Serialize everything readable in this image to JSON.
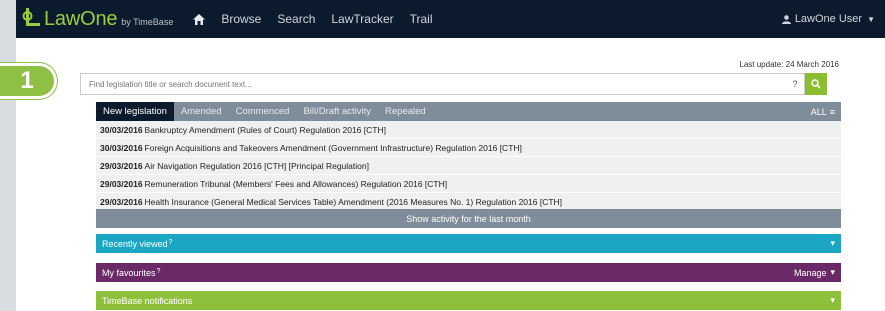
{
  "brand": {
    "name": "LawOne",
    "sub": "by TimeBase"
  },
  "nav": [
    "Browse",
    "Search",
    "LawTracker",
    "Trail"
  ],
  "user": {
    "name": "LawOne User"
  },
  "last_update": "Last update: 24 March 2016",
  "search": {
    "placeholder": "Find legislation title or search document text...",
    "help": "?"
  },
  "badge": "1",
  "tabs": [
    "New legislation",
    "Amended",
    "Commenced",
    "Bill/Draft activity",
    "Repealed"
  ],
  "tab_all": "ALL",
  "items": [
    {
      "date": "30/03/2016",
      "title": "Bankruptcy Amendment (Rules of Court) Regulation 2016 [CTH]"
    },
    {
      "date": "30/03/2016",
      "title": "Foreign Acquisitions and Takeovers Amendment (Government Infrastructure) Regulation 2016 [CTH]"
    },
    {
      "date": "29/03/2016",
      "title": "Air Navigation Regulation 2016 [CTH] [Principal Regulation]"
    },
    {
      "date": "29/03/2016",
      "title": "Remuneration Tribunal (Members' Fees and Allowances) Regulation 2016 [CTH]"
    },
    {
      "date": "29/03/2016",
      "title": "Health Insurance (General Medical Services Table) Amendment (2016 Measures No. 1) Regulation 2016 [CTH]"
    }
  ],
  "show_more": "Show activity for the last month",
  "panels": {
    "recent": {
      "label": "Recently viewed",
      "q": "?"
    },
    "favourites": {
      "label": "My favourites",
      "q": "?",
      "manage": "Manage"
    },
    "notifications": {
      "label": "TimeBase notifications"
    }
  },
  "colors": {
    "navbar": "#0c1a2e",
    "accent_green": "#8ec044",
    "tabs_bar": "#7f8c99",
    "recent": "#1ba7c4",
    "favourites": "#6a2a67",
    "notifications": "#8fc03b"
  }
}
